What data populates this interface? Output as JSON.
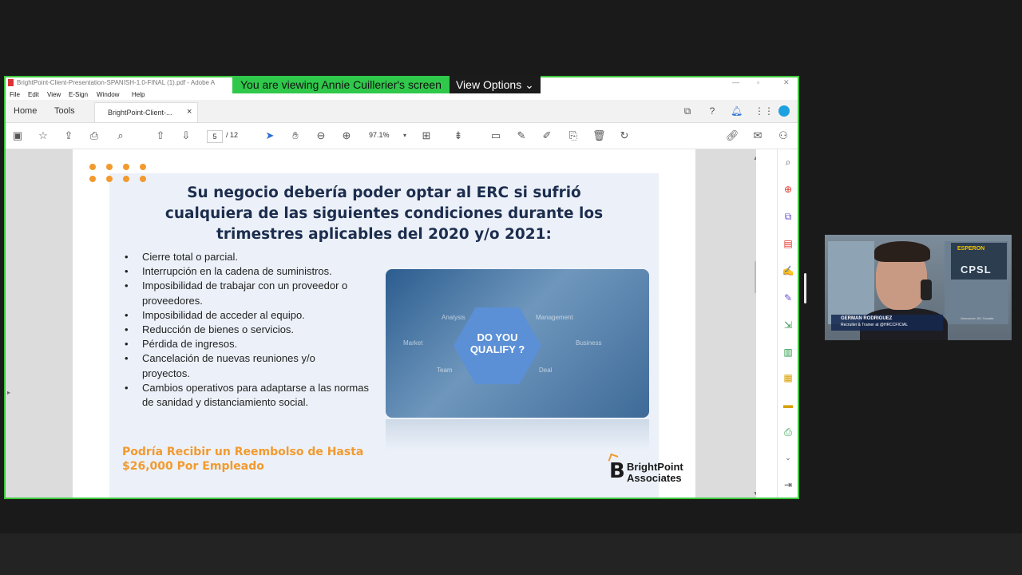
{
  "banner": {
    "message": "You are viewing Annie Cuillerier's screen",
    "view_options": "View Options ⌄"
  },
  "acrobat": {
    "window_title": "BrightPoint-Client-Presentation-SPANISH-1.0-FINAL (1).pdf - Adobe A",
    "menu": [
      "File",
      "Edit",
      "View",
      "E-Sign",
      "Window",
      "Help"
    ],
    "tabs": {
      "home": "Home",
      "tools": "Tools",
      "document": "BrightPoint-Client-...",
      "close": "×"
    },
    "page_current": "5",
    "page_total": "/ 12",
    "zoom": "97.1%"
  },
  "slide": {
    "title_lines": [
      "Su negocio debería poder optar al ERC si sufrió",
      "cualquiera de las siguientes condiciones durante los",
      "trimestres aplicables del 2020 y/o 2021:"
    ],
    "bullets": [
      "Cierre total o parcial.",
      "Interrupción en la cadena de suministros.",
      "Imposibilidad de trabajar con un proveedor o proveedores.",
      "Imposibilidad de acceder al equipo.",
      "Reducción de bienes o servicios.",
      "Pérdida de ingresos.",
      "Cancelación de nuevas reuniones y/o proyectos.",
      "Cambios operativos para adaptarse a las normas de sanidad y distanciamiento social."
    ],
    "promo_lines": [
      "Podría Recibir un Reembolso de Hasta",
      "$26,000 Por Empleado"
    ],
    "photo_text": [
      "DO YOU",
      "QUALIFY ?"
    ],
    "photo_words": [
      "Analysis",
      "Market",
      "Business",
      "Team",
      "Deal",
      "Management"
    ],
    "logo_lines": [
      "BrightPoint",
      "Associates"
    ],
    "logo_mark": "B"
  },
  "webcam": {
    "badge_top": "ESPERON",
    "badge_main": "CPSL",
    "name": "GERMAN RODRIGUEZ",
    "subtitle": "Recruiter & Trainer at @HRCCFICIAL",
    "location": "Vancouver, BC Canada"
  },
  "colors": {
    "accent_orange": "#f29a2e",
    "frame_green": "#3cc83c",
    "title_navy": "#1c2d4e"
  }
}
